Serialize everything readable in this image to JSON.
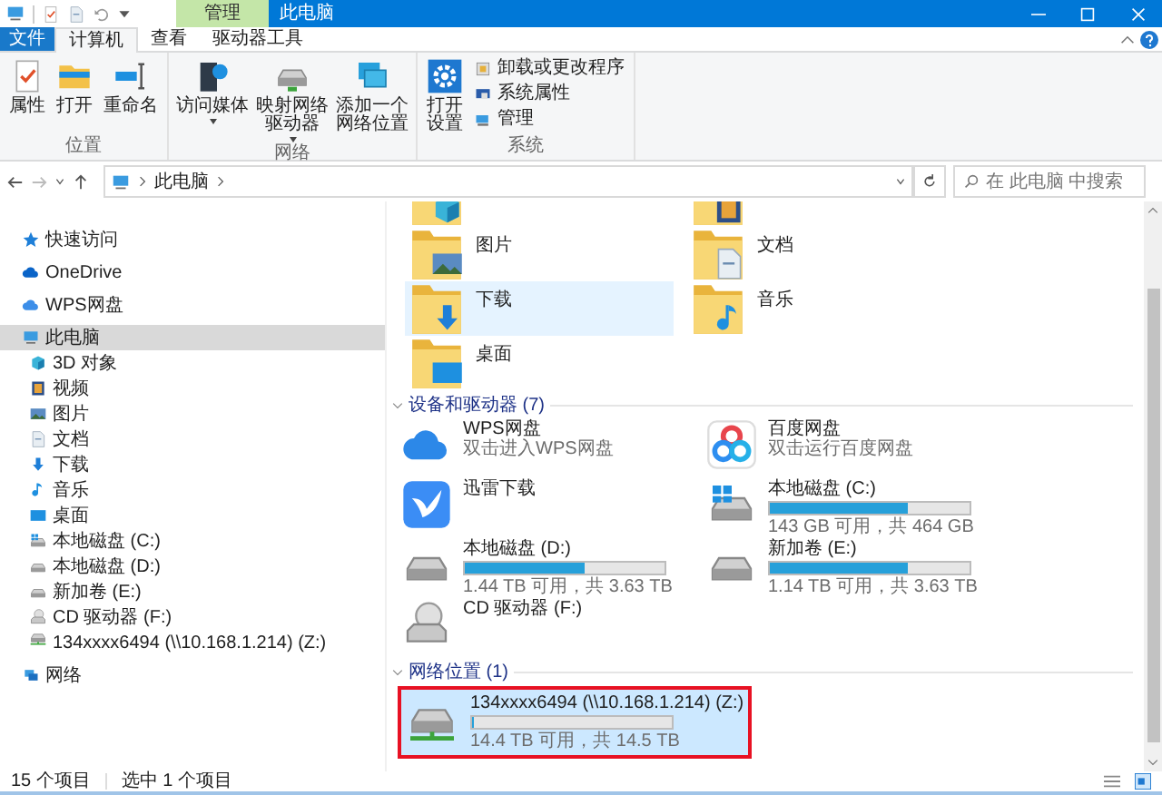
{
  "title_bar": {
    "context_tab": "管理",
    "title": "此电脑"
  },
  "file_menu": "文件",
  "ribbon_tabs": [
    {
      "label": "计算机",
      "selected": true
    },
    {
      "label": "查看",
      "selected": false
    },
    {
      "label": "驱动器工具",
      "selected": false
    }
  ],
  "ribbon_groups": [
    {
      "label": "位置",
      "buttons": [
        {
          "label": "属性",
          "dropdown": false
        },
        {
          "label": "打开",
          "dropdown": false
        },
        {
          "label": "重命名",
          "dropdown": false
        }
      ]
    },
    {
      "label": "网络",
      "buttons": [
        {
          "label": "访问媒体",
          "dropdown": true
        },
        {
          "label": "映射网络驱动器",
          "dropdown": true
        },
        {
          "label": "添加一个网络位置",
          "dropdown": false
        }
      ]
    },
    {
      "label": "系统",
      "buttons": [
        {
          "label": "打开设置",
          "dropdown": false
        }
      ],
      "small_buttons": [
        "卸载或更改程序",
        "系统属性",
        "管理"
      ]
    }
  ],
  "address_bar": {
    "path": "此电脑",
    "search_placeholder": "在 此电脑 中搜索"
  },
  "sidebar": [
    {
      "label": "快速访问",
      "selected": false
    },
    {
      "label": "OneDrive",
      "selected": false
    },
    {
      "label": "WPS网盘",
      "selected": false
    },
    {
      "label": "此电脑",
      "selected": true,
      "children": [
        {
          "label": "3D 对象",
          "selected": false
        },
        {
          "label": "视频",
          "selected": false
        },
        {
          "label": "图片",
          "selected": false
        },
        {
          "label": "文档",
          "selected": false
        },
        {
          "label": "下载",
          "selected": false
        },
        {
          "label": "音乐",
          "selected": false
        },
        {
          "label": "桌面",
          "selected": false
        },
        {
          "label": "本地磁盘 (C:)",
          "selected": false
        },
        {
          "label": "本地磁盘 (D:)",
          "selected": false
        },
        {
          "label": "新加卷 (E:)",
          "selected": false
        },
        {
          "label": "CD 驱动器 (F:)",
          "selected": false
        },
        {
          "label": "134xxxx6494 (\\\\10.168.1.214) (Z:)",
          "selected": false
        }
      ]
    },
    {
      "label": "网络",
      "selected": false
    }
  ],
  "folders": [
    {
      "selected": false
    },
    {
      "selected": false
    },
    {
      "name": "图片",
      "selected": false
    },
    {
      "name": "文档",
      "selected": false
    },
    {
      "name": "下载",
      "selected": true
    },
    {
      "name": "音乐",
      "selected": false
    },
    {
      "name": "桌面",
      "selected": false
    }
  ],
  "devices_header": "设备和驱动器 (7)",
  "devices": [
    {
      "kind": "app",
      "name": "WPS网盘",
      "subtitle": "双击进入WPS网盘"
    },
    {
      "kind": "app",
      "name": "百度网盘",
      "subtitle": "双击运行百度网盘"
    },
    {
      "kind": "app",
      "name": "迅雷下载"
    },
    {
      "kind": "drive",
      "name": "本地磁盘 (C:)",
      "level": 0.69,
      "free": "143 GB 可用，共 464 GB"
    },
    {
      "kind": "drive",
      "name": "本地磁盘 (D:)",
      "level": 0.6,
      "free": "1.44 TB 可用，共 3.63 TB"
    },
    {
      "kind": "drive",
      "name": "新加卷 (E:)",
      "level": 0.69,
      "free": "1.14 TB 可用，共 3.63 TB"
    },
    {
      "kind": "app",
      "name": "CD 驱动器 (F:)"
    }
  ],
  "network_header": "网络位置 (1)",
  "network": [
    {
      "kind": "drive",
      "name": "134xxxx6494 (\\\\10.168.1.214) (Z:)",
      "level": 0.01,
      "free": "14.4 TB 可用，共 14.5 TB",
      "selected": true,
      "highlighted": true
    }
  ],
  "status_bar": {
    "count": "15 个项目",
    "selection": "选中 1 个项目"
  }
}
